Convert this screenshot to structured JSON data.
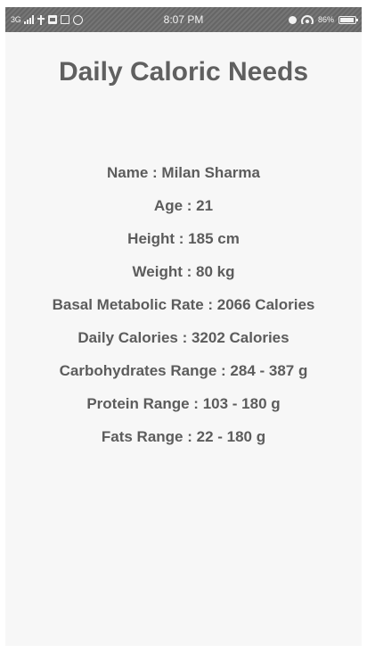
{
  "status_bar": {
    "network": "3G",
    "time": "8:07 PM",
    "battery": "86%",
    "icons": [
      "signal-icon",
      "usb-icon",
      "notification-icon",
      "screenshot-icon",
      "whatsapp-icon",
      "alarm-icon",
      "wifi-icon",
      "battery-icon"
    ]
  },
  "page": {
    "title": "Daily Caloric Needs"
  },
  "details": [
    "Name : Milan Sharma",
    "Age : 21",
    "Height : 185 cm",
    "Weight : 80 kg",
    "Basal Metabolic Rate : 2066 Calories",
    "Daily Calories : 3202 Calories",
    "Carbohydrates Range : 284 - 387 g",
    "Protein Range : 103 - 180 g",
    "Fats Range : 22 - 180 g"
  ],
  "colors": {
    "status_bar_bg": "#6b6b6b",
    "screen_bg": "#f7f7f7",
    "title_text": "#606060",
    "body_text": "#5c5c5c"
  }
}
